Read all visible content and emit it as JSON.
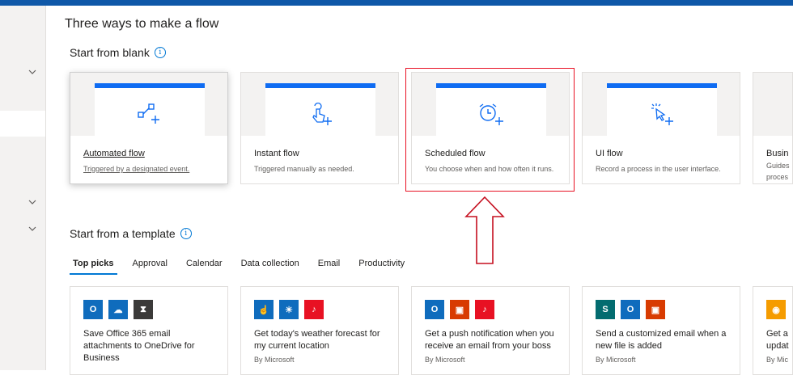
{
  "page": {
    "title": "Three ways to make a flow"
  },
  "blank_section": {
    "title": "Start from blank",
    "cards": [
      {
        "title": "Automated flow",
        "subtitle": "Triggered by a designated event.",
        "icon": "automated-flow-icon"
      },
      {
        "title": "Instant flow",
        "subtitle": "Triggered manually as needed.",
        "icon": "instant-touch-icon"
      },
      {
        "title": "Scheduled flow",
        "subtitle": "You choose when and how often it runs.",
        "icon": "alarm-clock-icon"
      },
      {
        "title": "UI flow",
        "subtitle": "Record a process in the user interface.",
        "icon": "cursor-click-icon"
      },
      {
        "title": "Busin",
        "subtitle": "Guides",
        "subtitle2": "proces",
        "icon": ""
      }
    ]
  },
  "template_section": {
    "title": "Start from a template",
    "tabs": [
      "Top picks",
      "Approval",
      "Calendar",
      "Data collection",
      "Email",
      "Productivity"
    ],
    "active_tab": "Top picks",
    "cards": [
      {
        "title": "Save Office 365 email attachments to OneDrive for Business",
        "by": "",
        "icons": [
          "outlook-icon",
          "onedrive-icon",
          "hourglass-icon"
        ]
      },
      {
        "title": "Get today's weather forecast for my current location",
        "by": "By Microsoft",
        "icons": [
          "touch-button-icon",
          "weather-sun-icon",
          "notification-bell-icon"
        ]
      },
      {
        "title": "Get a push notification when you receive an email from your boss",
        "by": "By Microsoft",
        "icons": [
          "outlook-icon",
          "office-icon",
          "notification-bell-icon"
        ]
      },
      {
        "title": "Send a customized email when a new file is added",
        "by": "By Microsoft",
        "icons": [
          "sharepoint-icon",
          "outlook-icon",
          "office-icon"
        ]
      },
      {
        "title": "Get a",
        "title2": "updat",
        "by": "By Mic",
        "icons": [
          "rss-icon"
        ]
      }
    ]
  },
  "colors": {
    "accent": "#0f6cf2",
    "topbar": "#0f58a8",
    "highlight": "#e81123",
    "outlook": "#0f6cbd",
    "office": "#d83b01",
    "bell": "#e81123",
    "hourglass": "#3b3a39",
    "sharepoint": "#036c70",
    "rss": "#f59c00"
  }
}
